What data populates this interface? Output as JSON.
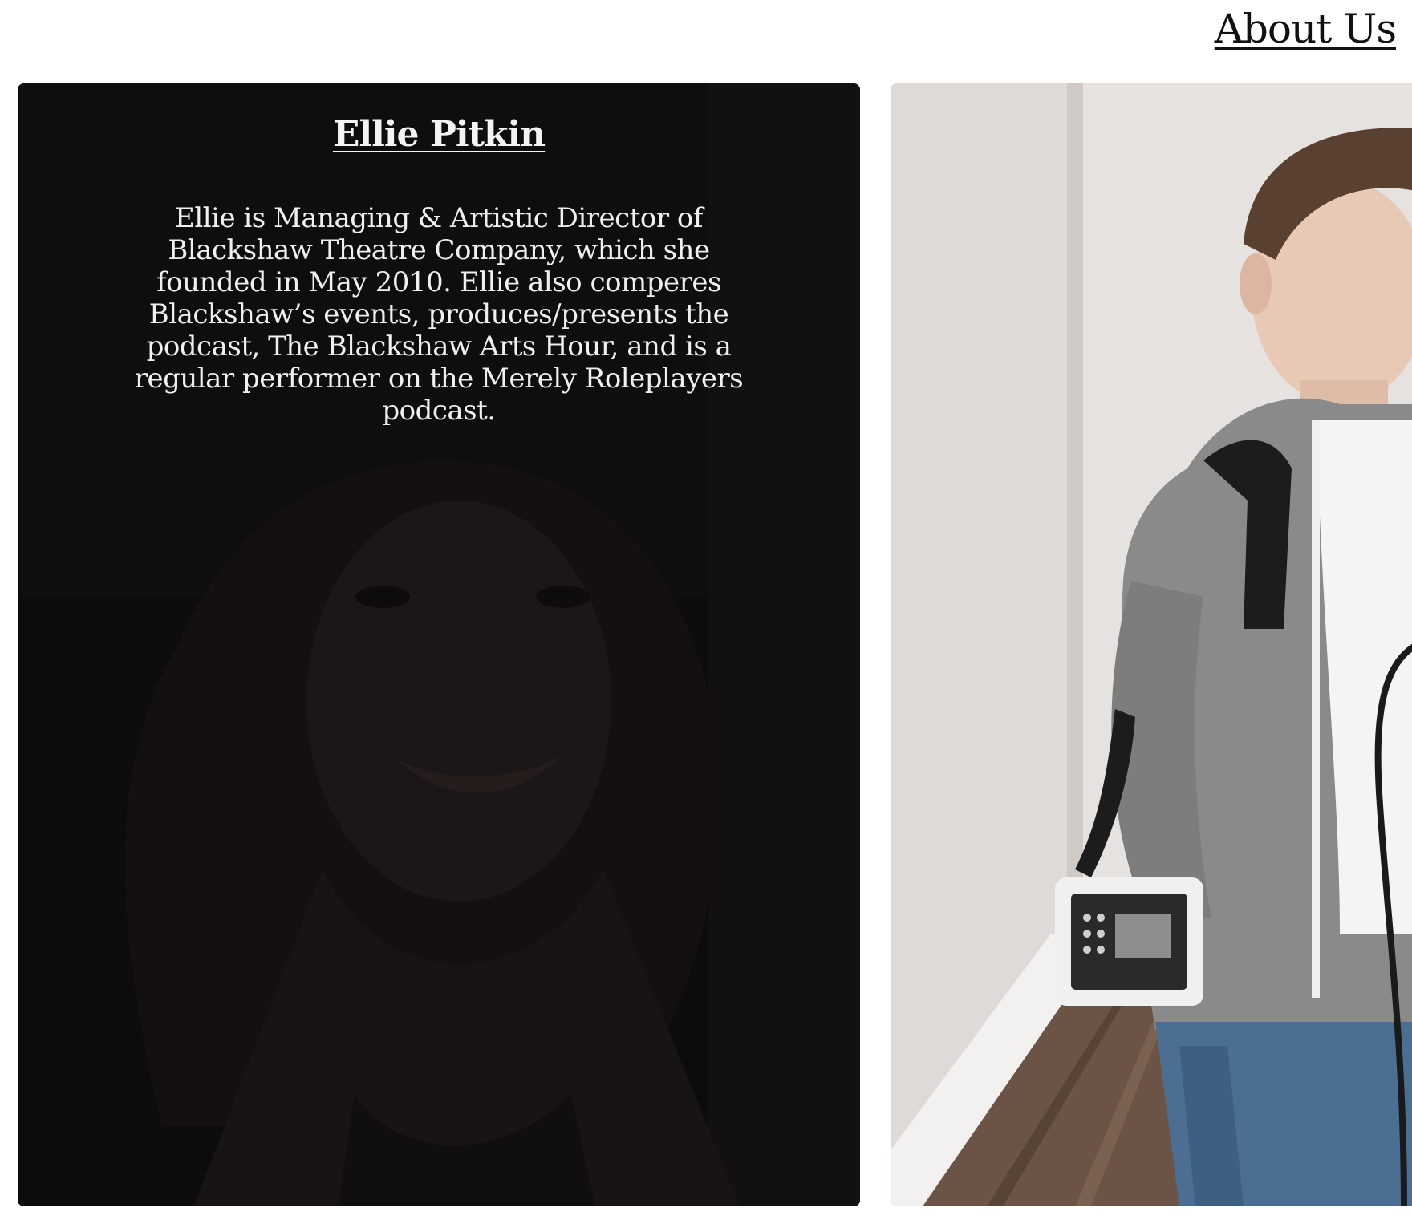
{
  "nav": {
    "about_label": "About Us"
  },
  "members": [
    {
      "name": "Ellie Pitkin",
      "bio": "Ellie is Managing & Artistic Director of Blackshaw Theatre Company, which she founded in May 2010. Ellie also comperes Blackshaw’s events, produces/presents the podcast, The Blackshaw Arts Hour, and is a regular performer on the Merely Roleplayers podcast."
    }
  ],
  "colors": {
    "card_dark": "#161414",
    "text_light": "#f2f2f2",
    "link_dark": "#111111"
  }
}
